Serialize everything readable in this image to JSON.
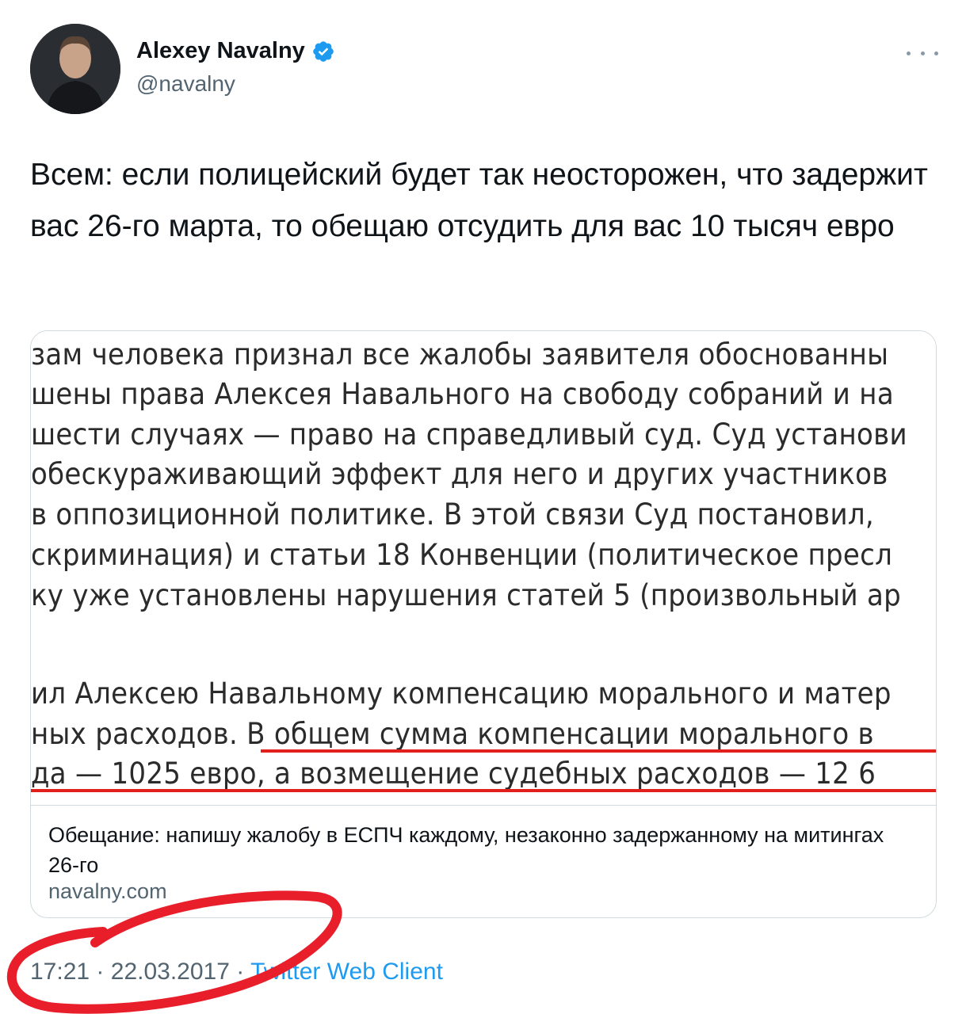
{
  "author": {
    "display_name": "Alexey Navalny",
    "handle": "@navalny",
    "verified_icon": "verified-badge-icon",
    "avatar_icon": "avatar"
  },
  "tweet": {
    "text": "Всем: если полицейский будет так неосторожен, что задержит вас 26-го марта, то обещаю отсудить для вас 10 тысяч евро"
  },
  "card": {
    "image_lines": [
      "зам человека признал все жалобы заявителя обоснованны",
      "шены права Алексея Навального на свободу собраний и на",
      "шести случаях — право на справедливый суд. Суд установи",
      "обескураживающий эффект для него и других участников",
      "в оппозиционной политике. В этой связи Суд постановил,",
      "скриминация) и статьи 18 Конвенции (политическое пресл",
      "ку уже установлены нарушения статей 5 (произвольный ар",
      "ил Алексею Навальному компенсацию морального и матер",
      "ных расходов. В общем сумма компенсации морального в",
      "да — 1025 евро, а возмещение судебных расходов — 12 6"
    ],
    "title": "Обещание: напишу жалобу в ЕСПЧ каждому, незаконно задержанному на митингах 26-го",
    "domain": "navalny.com"
  },
  "meta": {
    "time": "17:21",
    "separator": "·",
    "date": "22.03.2017",
    "source": "Twitter Web Client"
  },
  "colors": {
    "accent": "#1d9bf0",
    "secondary_text": "#536471",
    "annotation_red": "#e81f2a",
    "underline_red": "#e1201b"
  }
}
